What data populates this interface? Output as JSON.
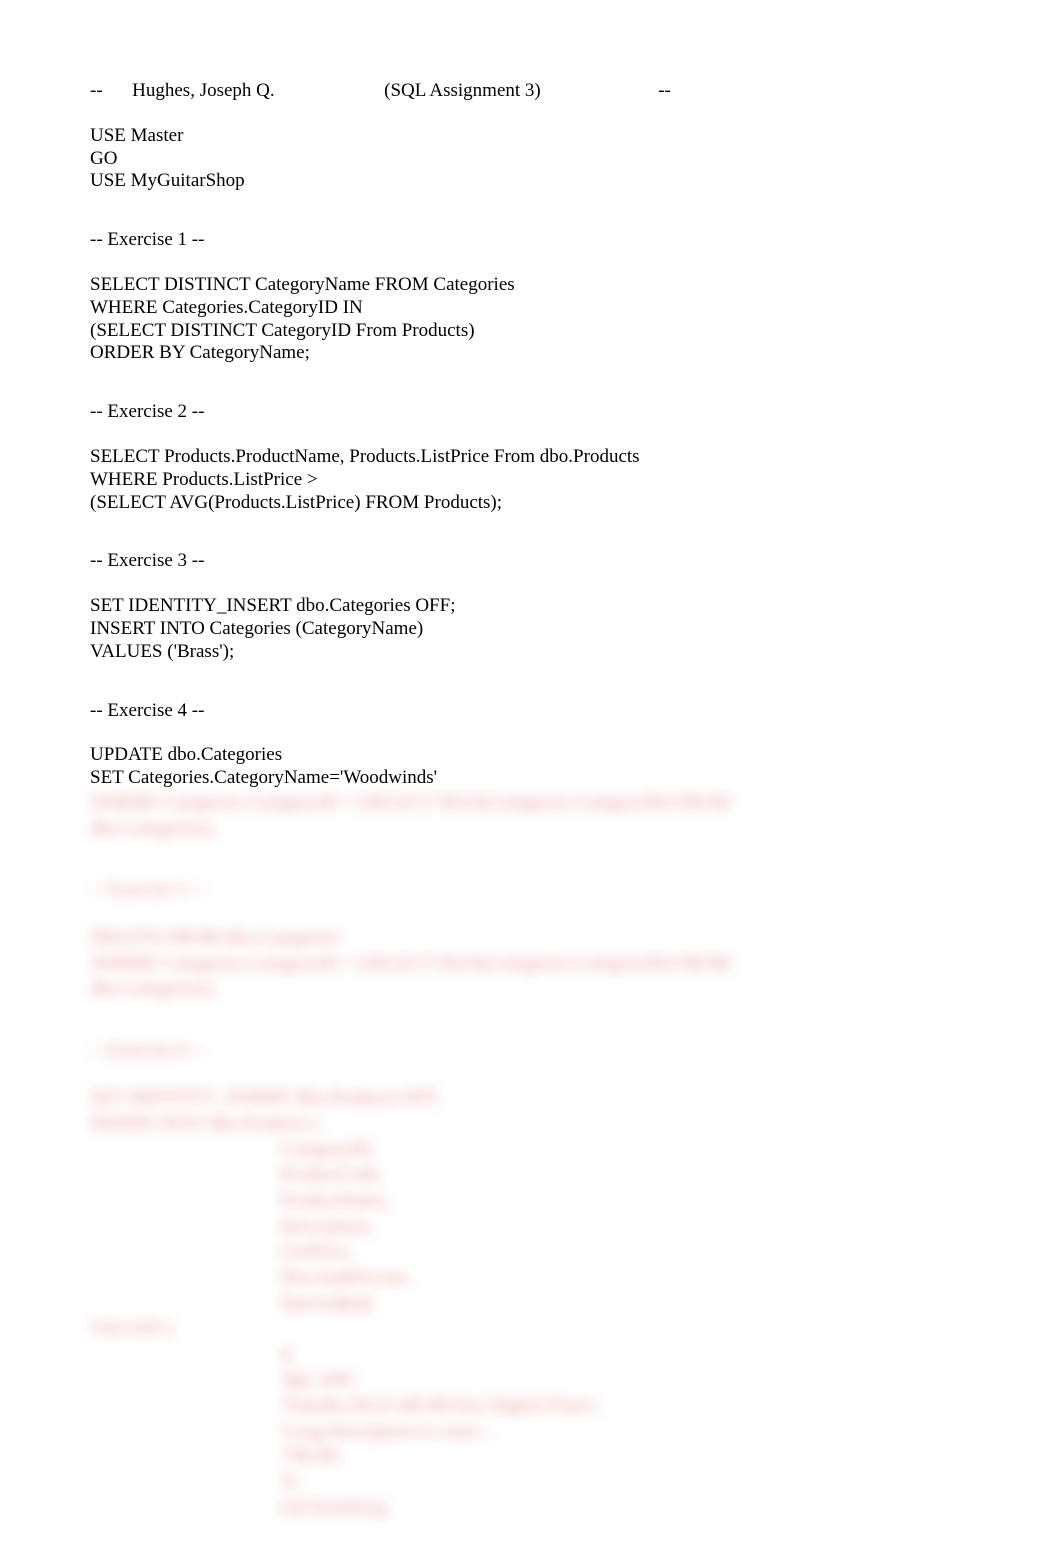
{
  "header": {
    "dashes_left": "--",
    "author": "Hughes, Joseph Q.",
    "title": "(SQL Assignment 3)",
    "dashes_right": "--"
  },
  "preamble": {
    "lines": [
      "USE Master",
      "GO",
      "USE MyGuitarShop"
    ]
  },
  "ex1": {
    "heading": "-- Exercise 1 --",
    "lines": [
      "SELECT DISTINCT CategoryName FROM Categories",
      "WHERE Categories.CategoryID IN",
      "(SELECT DISTINCT CategoryID From Products)",
      "ORDER BY CategoryName;"
    ]
  },
  "ex2": {
    "heading": "-- Exercise 2 --",
    "lines": [
      "SELECT Products.ProductName, Products.ListPrice From dbo.Products",
      "WHERE Products.ListPrice >",
      "(SELECT AVG(Products.ListPrice) FROM Products);"
    ]
  },
  "ex3": {
    "heading": "-- Exercise 3 --",
    "lines": [
      "SET IDENTITY_INSERT dbo.Categories OFF;",
      "INSERT INTO Categories (CategoryName)",
      "VALUES ('Brass');"
    ]
  },
  "ex4": {
    "heading": "-- Exercise 4 --",
    "lines": [
      "UPDATE dbo.Categories",
      "SET Categories.CategoryName='Woodwinds'"
    ]
  },
  "blurred": {
    "block1": [
      "WHERE Categories.CategoryID = (SELECT MAX(Categories.CategoryID) FROM",
      "dbo.Categories);"
    ],
    "block2_heading": "-- Exercise 5 --",
    "block2": [
      "DELETE FROM dbo.Categories",
      "WHERE Categories.CategoryID = (SELECT MAX(Categories.CategoryID) FROM",
      "dbo.Categories);"
    ],
    "block3_heading": "-- Exercise 6 --",
    "block3": [
      "SET IDENTITY_INSERT dbo.Products OFF;",
      "INSERT INTO dbo.Products ("
    ],
    "block3_indent": [
      "CategoryID,",
      "ProductCode,",
      "ProductName,",
      "Description,",
      "ListPrice,",
      "DiscountPercent,",
      "DateAdded)"
    ],
    "values_label": "VALUES (",
    "block3_values": [
      "4,",
      "'dgx_640',",
      "'Yamaha DGX 640 88-Key Digital Piano',",
      "'Long description to come.',",
      "'799.99',",
      "'0',",
      "GETDATE());"
    ]
  }
}
